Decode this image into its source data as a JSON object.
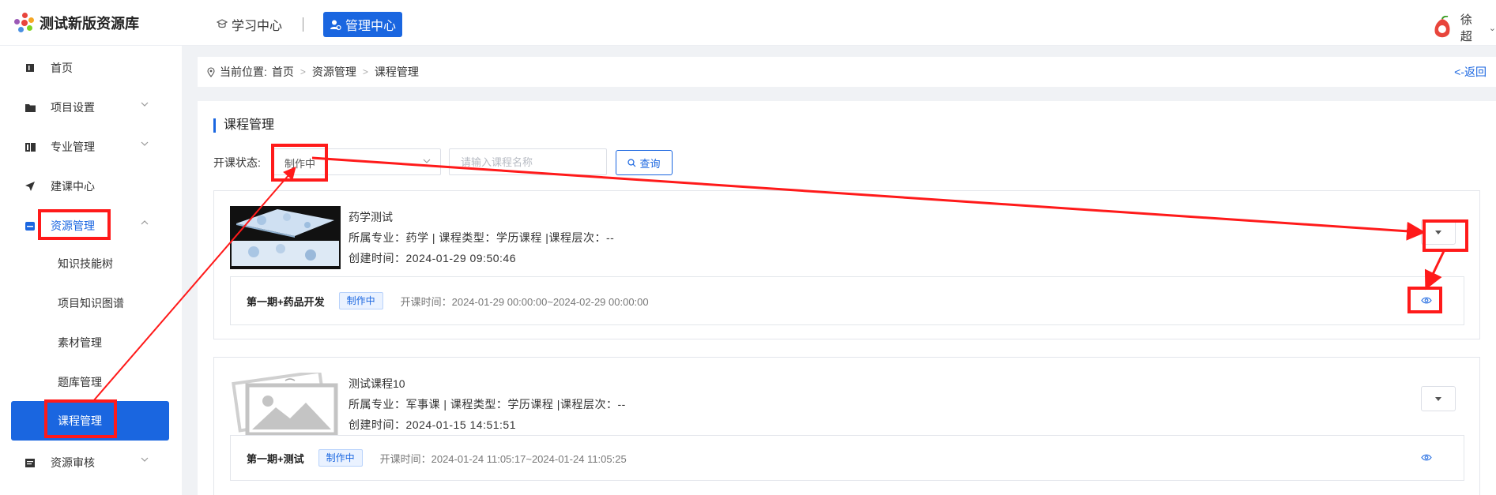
{
  "header": {
    "app_title": "测试新版资源库",
    "nav_study": "学习中心",
    "nav_admin": "管理中心",
    "user_name": "徐超"
  },
  "sidebar": {
    "items": [
      {
        "label": "首页"
      },
      {
        "label": "项目设置"
      },
      {
        "label": "专业管理"
      },
      {
        "label": "建课中心"
      },
      {
        "label": "资源管理"
      },
      {
        "label": "资源审核"
      }
    ],
    "sub_items": [
      {
        "label": "知识技能树"
      },
      {
        "label": "项目知识图谱"
      },
      {
        "label": "素材管理"
      },
      {
        "label": "题库管理"
      },
      {
        "label": "课程管理"
      }
    ]
  },
  "breadcrumb": {
    "prefix": "当前位置:",
    "items": [
      "首页",
      "资源管理",
      "课程管理"
    ],
    "back": "<-返回"
  },
  "main": {
    "title": "课程管理",
    "filter_label": "开课状态:",
    "status_value": "制作中",
    "search_placeholder": "请输入课程名称",
    "query_label": "查询"
  },
  "courses": [
    {
      "name": "药学测试",
      "meta": "所属专业：药学  | 课程类型：学历课程 |课程层次：--",
      "created": "创建时间：2024-01-29 09:50:46",
      "period_name": "第一期+药品开发",
      "period_status": "制作中",
      "period_time": "开课时间：2024-01-29 00:00:00~2024-02-29 00:00:00"
    },
    {
      "name": "测试课程10",
      "meta": "所属专业：军事课  | 课程类型：学历课程 |课程层次：--",
      "created": "创建时间：2024-01-15 14:51:51",
      "period_name": "第一期+测试",
      "period_status": "制作中",
      "period_time": "开课时间：2024-01-24 11:05:17~2024-01-24 11:05:25"
    }
  ],
  "colors": {
    "brand": "#1a66e0",
    "annotation": "#ff1a1a"
  }
}
